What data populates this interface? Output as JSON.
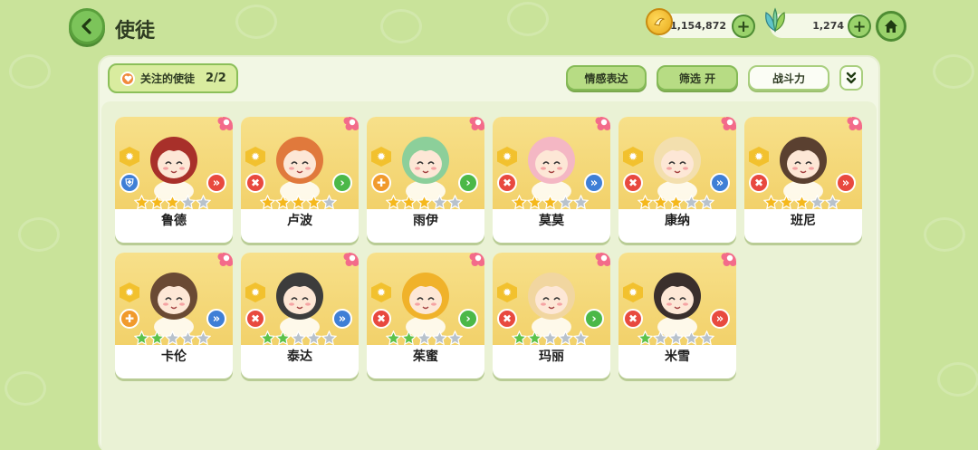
{
  "header": {
    "title": "使徒",
    "gold_amount": "1,154,872",
    "leaf_amount": "1,274"
  },
  "toolbar": {
    "favorites_label": "关注的使徒",
    "favorites_count": "2/2",
    "emote_label": "情感表达",
    "filter_label": "筛选 开",
    "power_label": "战斗力"
  },
  "colors": {
    "background": "#c9e39a",
    "panel": "#f2f7e4",
    "accent_green": "#7cc45a",
    "card_art": "#f2d16a",
    "star_gold": "#f5b81c",
    "star_green": "#5cc24a",
    "star_empty": "#b8c2cc"
  },
  "characters": [
    {
      "name": "鲁德",
      "stars": 3,
      "star_color": "gold",
      "role_icon": "shield-icon",
      "role_color": "#3f7fd6",
      "type_color": "#e8493f",
      "type_icon": "double-chevron-icon",
      "hair": "#a8302a"
    },
    {
      "name": "卢波",
      "stars": 4,
      "star_color": "gold",
      "role_icon": "crossed-swords-icon",
      "role_color": "#e8493f",
      "type_color": "#4cb848",
      "type_icon": "chevron-icon",
      "hair": "#e0793c"
    },
    {
      "name": "雨伊",
      "stars": 3,
      "star_color": "gold",
      "role_icon": "cross-heal-icon",
      "role_color": "#f19a2c",
      "type_color": "#4cb848",
      "type_icon": "chevron-icon",
      "hair": "#8ccf9a"
    },
    {
      "name": "莫莫",
      "stars": 3,
      "star_color": "gold",
      "role_icon": "crossed-swords-icon",
      "role_color": "#e8493f",
      "type_color": "#3f7fd6",
      "type_icon": "double-chevron-icon",
      "hair": "#f4b7c4"
    },
    {
      "name": "康纳",
      "stars": 3,
      "star_color": "gold",
      "role_icon": "crossed-swords-icon",
      "role_color": "#e8493f",
      "type_color": "#3f7fd6",
      "type_icon": "double-chevron-icon",
      "hair": "#f3dfae"
    },
    {
      "name": "班尼",
      "stars": 3,
      "star_color": "gold",
      "role_icon": "crossed-swords-icon",
      "role_color": "#e8493f",
      "type_color": "#e8493f",
      "type_icon": "double-chevron-icon",
      "hair": "#5a4030"
    },
    {
      "name": "卡伦",
      "stars": 2,
      "star_color": "green",
      "role_icon": "cross-heal-icon",
      "role_color": "#f19a2c",
      "type_color": "#3f7fd6",
      "type_icon": "double-chevron-icon",
      "hair": "#6a4a34"
    },
    {
      "name": "泰达",
      "stars": 2,
      "star_color": "green",
      "role_icon": "crossed-swords-icon",
      "role_color": "#e8493f",
      "type_color": "#3f7fd6",
      "type_icon": "double-chevron-icon",
      "hair": "#3c3c3c"
    },
    {
      "name": "茱蜜",
      "stars": 2,
      "star_color": "green",
      "role_icon": "crossed-swords-icon",
      "role_color": "#e8493f",
      "type_color": "#4cb848",
      "type_icon": "chevron-icon",
      "hair": "#f0b22a"
    },
    {
      "name": "玛丽",
      "stars": 2,
      "star_color": "green",
      "role_icon": "crossed-swords-icon",
      "role_color": "#e8493f",
      "type_color": "#4cb848",
      "type_icon": "chevron-icon",
      "hair": "#f1d6a0"
    },
    {
      "name": "米雪",
      "stars": 1,
      "star_color": "green",
      "role_icon": "crossed-swords-icon",
      "role_color": "#e8493f",
      "type_color": "#e8493f",
      "type_icon": "double-chevron-icon",
      "hair": "#3a2f2c"
    }
  ]
}
